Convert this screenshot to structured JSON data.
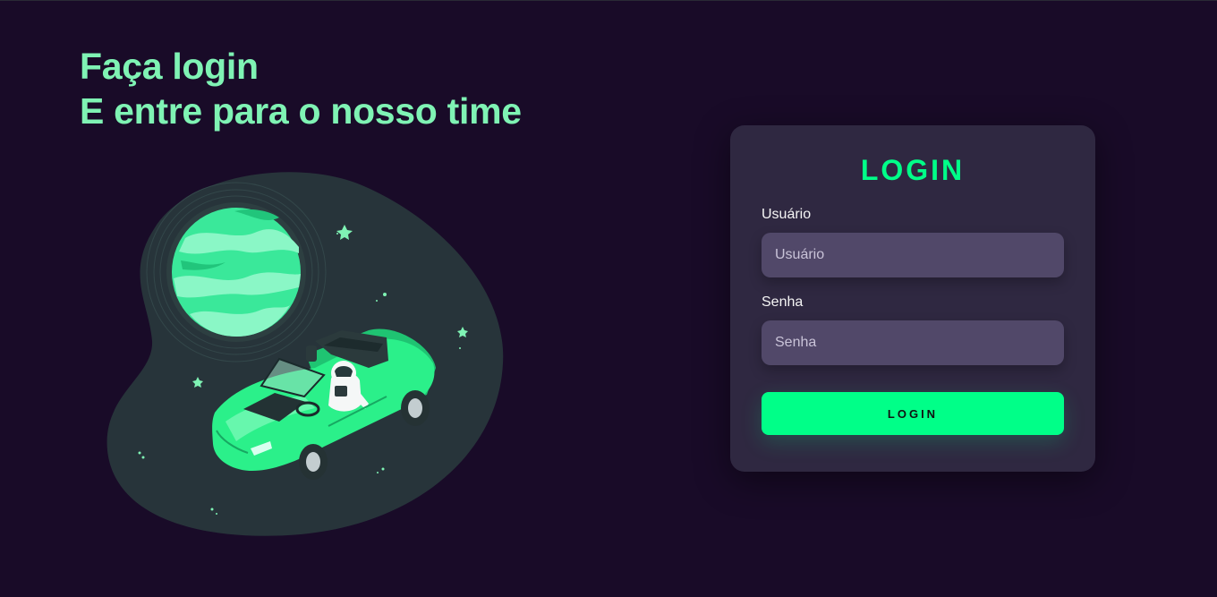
{
  "hero": {
    "line1": "Faça login",
    "line2": "E entre para o nosso time"
  },
  "login_form": {
    "title": "LOGIN",
    "username": {
      "label": "Usuário",
      "placeholder": "Usuário",
      "value": ""
    },
    "password": {
      "label": "Senha",
      "placeholder": "Senha",
      "value": ""
    },
    "submit_label": "LOGIN"
  },
  "illustration": {
    "icon": "astronaut-car-space-illustration"
  },
  "colors": {
    "background": "#190b28",
    "accent": "#00ff88",
    "heading": "#7ff3b4",
    "card": "#2f2841",
    "input": "#514869"
  }
}
